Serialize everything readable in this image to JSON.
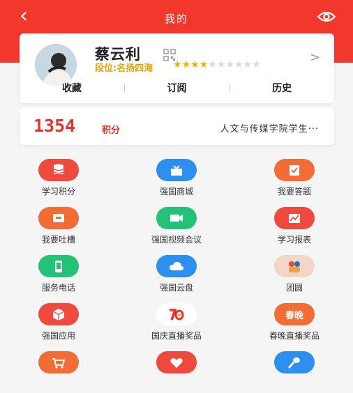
{
  "header": {
    "title": "我的"
  },
  "profile": {
    "name": "蔡云利",
    "rank_label": "段位:名扬四海",
    "stars_filled": 4,
    "stars_total": 10
  },
  "tabs": [
    {
      "label": "收藏"
    },
    {
      "label": "订阅"
    },
    {
      "label": "历史"
    }
  ],
  "score": {
    "points": "1354",
    "unit": "积分",
    "school": "人文与传媒学院学生···"
  },
  "grid": [
    {
      "label": "学习积分",
      "color": "#ef4a3d",
      "icon": "database-icon"
    },
    {
      "label": "强国商城",
      "color": "#2d8ff0",
      "icon": "shop-icon"
    },
    {
      "label": "我要答题",
      "color": "#f36b35",
      "icon": "quiz-icon"
    },
    {
      "label": "我要吐槽",
      "color": "#f36b35",
      "icon": "feedback-icon"
    },
    {
      "label": "强国视频会议",
      "color": "#23c277",
      "icon": "video-icon"
    },
    {
      "label": "学习报表",
      "color": "#ef4a3d",
      "icon": "report-icon"
    },
    {
      "label": "服务电话",
      "color": "#23c277",
      "icon": "phone-icon"
    },
    {
      "label": "强国云盘",
      "color": "#2d8ff0",
      "icon": "cloud-icon"
    },
    {
      "label": "团圆",
      "color": "#f3d6c9",
      "icon": "reunion-icon"
    },
    {
      "label": "强国应用",
      "color": "#ef4a3d",
      "icon": "cube-icon"
    },
    {
      "label": "国庆直播奖品",
      "color": "#ffffff",
      "icon": "70th-anniversary-icon"
    },
    {
      "label": "春晚直播奖品",
      "color": "#f36b35",
      "icon": "spring-gala-icon",
      "badge": "春晚"
    },
    {
      "label": "",
      "color": "#f36b35",
      "icon": "cart-icon"
    },
    {
      "label": "",
      "color": "#ef4a3d",
      "icon": "heart-icon"
    },
    {
      "label": "",
      "color": "#2d8ff0",
      "icon": "microphone-icon"
    }
  ]
}
